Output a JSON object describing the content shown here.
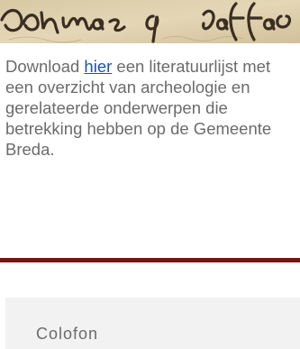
{
  "intro": {
    "before_link": "Download ",
    "link_text": "hier",
    "after_link": " een literatuurlijst met een overzicht van archeologie en gerelateerde onderwerpen die betrekking hebben op de Gemeente Breda."
  },
  "colofon": {
    "title": "Colofon"
  },
  "colors": {
    "accent": "#7a1414",
    "link": "#1a54a8",
    "text": "#6b6b6b",
    "panel": "#f2f2f2"
  }
}
